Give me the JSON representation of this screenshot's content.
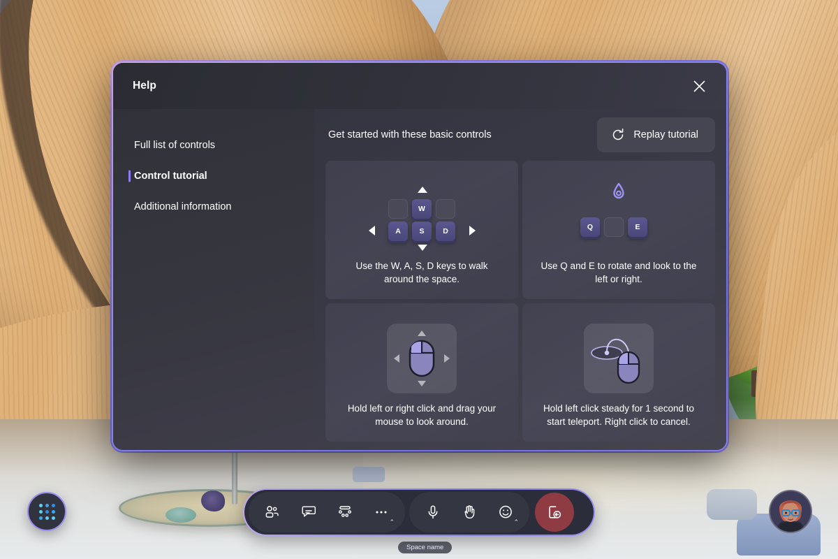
{
  "dialog": {
    "title": "Help",
    "close_icon": "close-icon",
    "sidebar": {
      "items": [
        {
          "label": "Full list of controls",
          "active": false
        },
        {
          "label": "Control tutorial",
          "active": true
        },
        {
          "label": "Additional information",
          "active": false
        }
      ]
    },
    "content": {
      "heading": "Get started with these basic controls",
      "replay_button": {
        "label": "Replay tutorial",
        "icon": "refresh-icon"
      },
      "cards": [
        {
          "id": "wasd",
          "caption": "Use the W, A, S, D keys to walk around the space.",
          "keys": {
            "up": "W",
            "left": "A",
            "down": "S",
            "right": "D"
          },
          "arrows": [
            "up",
            "down",
            "left",
            "right"
          ]
        },
        {
          "id": "qe",
          "caption": "Use Q and E to rotate and look to the left or right.",
          "keys": {
            "left": "Q",
            "right": "E"
          },
          "icon": "rotate-drop-icon"
        },
        {
          "id": "mouse-look",
          "caption": "Hold left or right click and drag your mouse to look around.",
          "icon": "mouse-drag-icon"
        },
        {
          "id": "teleport",
          "caption": "Hold left click steady for 1 second to start teleport. Right click to cancel.",
          "icon": "mouse-teleport-icon"
        }
      ]
    }
  },
  "toolbar": {
    "group_one": [
      {
        "name": "people-icon",
        "label": "People",
        "has_chevron": false
      },
      {
        "name": "chat-icon",
        "label": "Chat",
        "has_chevron": false
      },
      {
        "name": "reactions-icon",
        "label": "Reactions",
        "has_chevron": false
      },
      {
        "name": "more-icon",
        "label": "More",
        "has_chevron": true,
        "chevron": "⌃"
      }
    ],
    "group_two": [
      {
        "name": "microphone-icon",
        "label": "Mic",
        "has_chevron": false
      },
      {
        "name": "raise-hand-icon",
        "label": "Raise hand",
        "has_chevron": false
      },
      {
        "name": "emoji-icon",
        "label": "Emoji",
        "has_chevron": true,
        "chevron": "⌃"
      }
    ],
    "leave": {
      "name": "leave-icon",
      "label": "Leave"
    }
  },
  "space_name": "Space name",
  "apps_launcher": {
    "name": "apps-grid-icon",
    "label": "Apps"
  },
  "avatar": {
    "name": "user-avatar",
    "label": "Your avatar"
  },
  "colors": {
    "accent": "#8a7ff0",
    "border_gradient_start": "#caa4e8",
    "border_gradient_end": "#6f6fe0",
    "leave_red": "#8e3b44",
    "key_purple": "#4a4779",
    "dialog_bg": "#33343e"
  }
}
